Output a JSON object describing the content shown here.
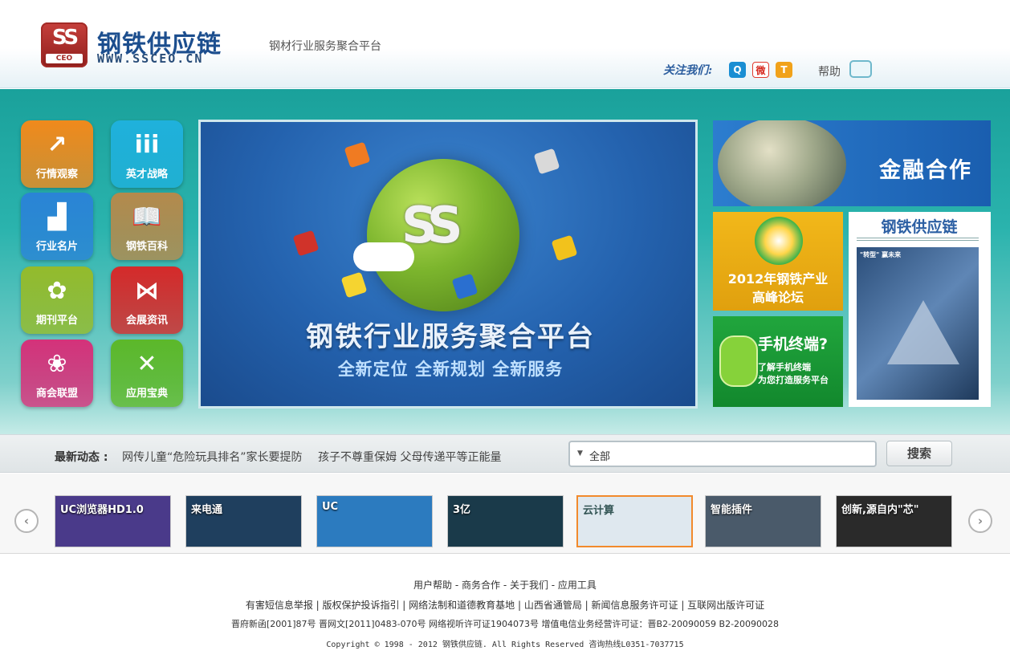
{
  "header": {
    "logo_badge_top": "SS",
    "logo_badge_bottom": "CEO",
    "logo_title": "钢铁供应链",
    "logo_url": "WWW.SSCEO.CN",
    "slogan": "钢材行业服务聚合平台",
    "follow_label": "关注我们:",
    "social": [
      {
        "name": "qq-zone",
        "glyph": "Q"
      },
      {
        "name": "sina-weibo",
        "glyph": "微"
      },
      {
        "name": "tencent-weibo",
        "glyph": "T"
      }
    ],
    "help_label": "帮助"
  },
  "tiles": [
    {
      "label": "行情观察",
      "icon": "chart-icon",
      "glyph": "↗",
      "color": "#f08a1c"
    },
    {
      "label": "英才战略",
      "icon": "people-icon",
      "glyph": "iii",
      "color": "#1fb1dc"
    },
    {
      "label": "行业名片",
      "icon": "factory-icon",
      "glyph": "▟",
      "color": "#2a84d6"
    },
    {
      "label": "钢铁百科",
      "icon": "book-icon",
      "glyph": "📖",
      "color": "#b48a4c"
    },
    {
      "label": "期刊平台",
      "icon": "open-book-icon",
      "glyph": "✿",
      "color": "#94bb2c"
    },
    {
      "label": "会展资讯",
      "icon": "bowtie-icon",
      "glyph": "⋈",
      "color": "#d52a2a"
    },
    {
      "label": "商会联盟",
      "icon": "swirl-icon",
      "glyph": "❀",
      "color": "#d4327a"
    },
    {
      "label": "应用宝典",
      "icon": "tools-icon",
      "glyph": "✕",
      "color": "#5cb82a"
    }
  ],
  "banner": {
    "logo": "SS",
    "title": "钢铁行业服务聚合平台",
    "subtitle": "全新定位 全新规划 全新服务"
  },
  "ads": {
    "finance": "金融合作",
    "forum_line1": "2012年钢铁产业",
    "forum_line2": "高峰论坛",
    "mobile_title": "手机终端?",
    "mobile_line1": "了解手机终端",
    "mobile_line2": "为您打造服务平台",
    "magazine_title": "钢铁供应链",
    "magazine_tag": "\"转型\" 赢未来"
  },
  "news": {
    "label": "最新动态 :",
    "items": [
      "网传儿童“危险玩具排名”家长要提防",
      "孩子不尊重保姆 父母传递平等正能量"
    ]
  },
  "search": {
    "selected": "全部",
    "button": "搜索"
  },
  "thumbs": [
    {
      "text": "UC浏览器HD1.0",
      "color": "#4a3a8a"
    },
    {
      "text": "来电通",
      "color": "#1f3f5e"
    },
    {
      "text": "UC",
      "color": "#2c7bbf"
    },
    {
      "text": "3亿",
      "color": "#1a3a4a"
    },
    {
      "text": "云计算",
      "color": "#dfe8ef"
    },
    {
      "text": "智能插件",
      "color": "#4a5a6a"
    },
    {
      "text": "创新,源自内\"芯\"",
      "color": "#2a2a2a"
    }
  ],
  "footer": {
    "links": "用户帮助 - 商务合作 - 关于我们 - 应用工具",
    "row2": "有害短信息举报 | 版权保护投诉指引 | 网络法制和道德教育基地 | 山西省通管局 | 新闻信息服务许可证 | 互联网出版许可证",
    "row3": "晋府新函[2001]87号 晋网文[2011]0483-070号 网络视听许可证1904073号 增值电信业务经营许可证：晋B2-20090059 B2-20090028",
    "row4": "Copyright © 1998 - 2012 钢铁供应链. All Rights Reserved     咨询热线L0351-7037715"
  }
}
